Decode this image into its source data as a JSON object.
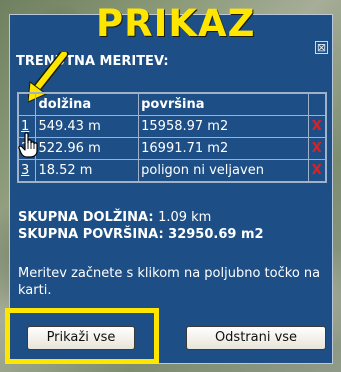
{
  "annotation": {
    "title": "PRIKAZ"
  },
  "panel": {
    "close_label": "⊠",
    "subtitle": "TRENUTNA MERITEV:",
    "table": {
      "headers": [
        "",
        "dolžina",
        "površina",
        ""
      ],
      "rows": [
        {
          "idx": "1",
          "length": "549.43 m",
          "area": "15958.97 m2",
          "delete": "X"
        },
        {
          "idx": "2",
          "length": "522.96 m",
          "area": "16991.71 m2",
          "delete": "X"
        },
        {
          "idx": "3",
          "length": "18.52 m",
          "area": "poligon ni veljaven",
          "delete": "X"
        }
      ]
    },
    "totals": {
      "length_label": "SKUPNA DOLŽINA:",
      "length_value": "1.09 km",
      "area_label": "SKUPNA POVRŠINA:",
      "area_value": "32950.69 m2"
    },
    "instructions": "Meritev začnete s klikom na poljubno točko na karti.",
    "buttons": {
      "show_all": "Prikaži vse",
      "remove_all": "Odstrani vse"
    }
  },
  "colors": {
    "panel_bg": "#1d4f86",
    "highlight": "#ffe600",
    "delete": "#e02020"
  }
}
